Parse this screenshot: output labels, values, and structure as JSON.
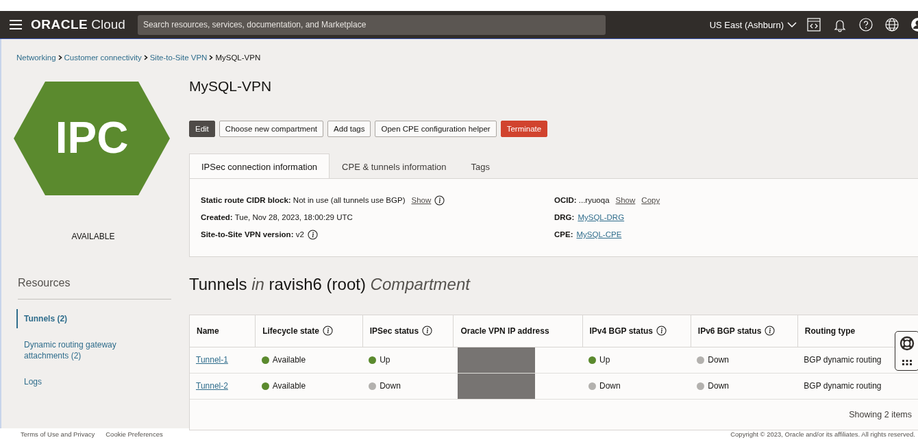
{
  "header": {
    "brand": "ORACLE",
    "product": "Cloud",
    "search": {
      "placeholder": "Search resources, services, documentation, and Marketplace"
    },
    "region": "US East (Ashburn)"
  },
  "breadcrumbs": [
    {
      "text": "Networking",
      "kind": "link"
    },
    {
      "text": "Customer connectivity",
      "kind": "link"
    },
    {
      "text": "Site-to-Site VPN",
      "kind": "link"
    },
    {
      "text": "MySQL-VPN",
      "kind": "current"
    }
  ],
  "badge": {
    "text": "IPC",
    "status": "AVAILABLE",
    "color": "#5b8a2e"
  },
  "title": "MySQL-VPN",
  "buttons": [
    {
      "label": "Edit",
      "kind": "dark"
    },
    {
      "label": "Choose new compartment",
      "kind": "default"
    },
    {
      "label": "Add tags",
      "kind": "default"
    },
    {
      "label": "Open CPE configuration helper",
      "kind": "default"
    },
    {
      "label": "Terminate",
      "kind": "danger"
    }
  ],
  "tabs": [
    {
      "label": "IPSec connection information",
      "selected": true
    },
    {
      "label": "CPE & tunnels information",
      "selected": false
    },
    {
      "label": "Tags",
      "selected": false
    }
  ],
  "details": {
    "left": [
      {
        "label": "Static route CIDR block:",
        "value": "Not in use (all tunnels use BGP)",
        "kind": "text",
        "links": [
          "Show"
        ],
        "info": true
      },
      {
        "label": "Created:",
        "value": "Tue, Nov 28, 2023, 18:00:29 UTC",
        "kind": "text",
        "info": false
      },
      {
        "label": "Site-to-Site VPN version:",
        "value": "v2",
        "kind": "text",
        "info": true
      }
    ],
    "right": [
      {
        "label": "OCID:",
        "value": "...ryuoqa",
        "kind": "text",
        "links": [
          "Show",
          "Copy"
        ],
        "info": false
      },
      {
        "label": "DRG:",
        "value": "MySQL-DRG",
        "kind": "link",
        "info": false
      },
      {
        "label": "CPE:",
        "value": "MySQL-CPE",
        "kind": "link",
        "info": false
      }
    ]
  },
  "resources": {
    "title": "Resources",
    "items": [
      {
        "label": "Tunnels (2)",
        "selected": true
      },
      {
        "label": "Dynamic routing gateway attachments (2)",
        "selected": false
      },
      {
        "label": "Logs",
        "selected": false
      }
    ]
  },
  "tunnels": {
    "heading": [
      {
        "text": "Tunnels ",
        "kind": "plain"
      },
      {
        "text": "in",
        "kind": "emphasis"
      },
      {
        "text": " ravish6 (root) ",
        "kind": "plain"
      },
      {
        "text": "Compartment",
        "kind": "emphasis"
      }
    ],
    "columns": [
      {
        "label": "Name",
        "info": false
      },
      {
        "label": "Lifecycle state",
        "info": true
      },
      {
        "label": "IPSec status",
        "info": true
      },
      {
        "label": "Oracle VPN IP address",
        "info": false
      },
      {
        "label": "IPv4 BGP status",
        "info": true
      },
      {
        "label": "IPv6 BGP status",
        "info": true
      },
      {
        "label": "Routing type",
        "info": false
      }
    ],
    "rows": [
      [
        {
          "kind": "link",
          "text": "Tunnel-1"
        },
        {
          "kind": "status",
          "text": "Available",
          "color": "#5b8a2e"
        },
        {
          "kind": "status",
          "text": "Up",
          "color": "#5b8a2e"
        },
        {
          "kind": "redacted"
        },
        {
          "kind": "status",
          "text": "Up",
          "color": "#5b8a2e"
        },
        {
          "kind": "status",
          "text": "Down",
          "color": "#b3b1ae"
        },
        {
          "kind": "text",
          "text": "BGP dynamic routing"
        }
      ],
      [
        {
          "kind": "link",
          "text": "Tunnel-2"
        },
        {
          "kind": "status",
          "text": "Available",
          "color": "#5b8a2e"
        },
        {
          "kind": "status",
          "text": "Down",
          "color": "#b3b1ae"
        },
        {
          "kind": "redacted"
        },
        {
          "kind": "status",
          "text": "Down",
          "color": "#b3b1ae"
        },
        {
          "kind": "status",
          "text": "Down",
          "color": "#b3b1ae"
        },
        {
          "kind": "text",
          "text": "BGP dynamic routing"
        }
      ]
    ],
    "footer": "Showing 2 items"
  },
  "footer": {
    "links": [
      "Terms of Use and Privacy",
      "Cookie Preferences"
    ],
    "copyright": "Copyright © 2023, Oracle and/or its affiliates. All rights reserved."
  }
}
